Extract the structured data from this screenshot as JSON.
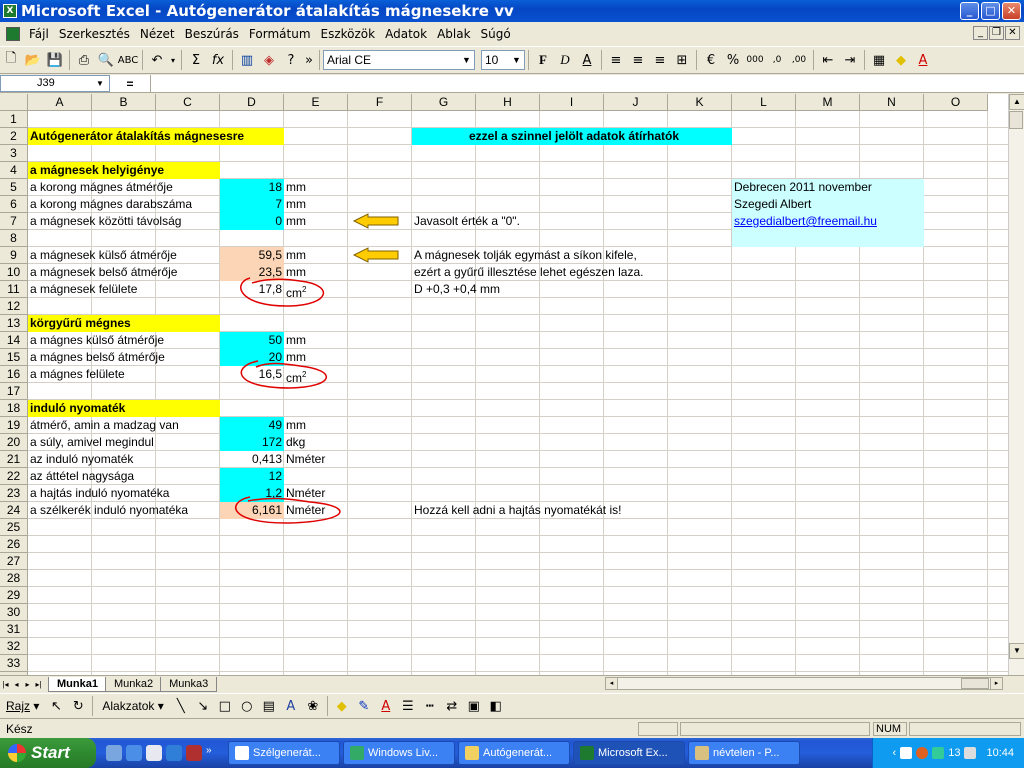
{
  "window": {
    "title": "Microsoft Excel - Autógenerátor átalakítás mágnesekre vv"
  },
  "menu": [
    "Fájl",
    "Szerkesztés",
    "Nézet",
    "Beszúrás",
    "Formátum",
    "Eszközök",
    "Adatok",
    "Ablak",
    "Súgó"
  ],
  "toolbar": {
    "font": "Arial CE",
    "size": "10"
  },
  "formula": {
    "cell_ref": "J39",
    "fx": "="
  },
  "columns": [
    "A",
    "B",
    "C",
    "D",
    "E",
    "F",
    "G",
    "H",
    "I",
    "J",
    "K",
    "L",
    "M",
    "N",
    "O"
  ],
  "rows": [
    "1",
    "2",
    "3",
    "4",
    "5",
    "6",
    "7",
    "8",
    "9",
    "10",
    "11",
    "12",
    "13",
    "14",
    "15",
    "16",
    "17",
    "18",
    "19",
    "20",
    "21",
    "22",
    "23",
    "24",
    "25",
    "26",
    "27",
    "28",
    "29",
    "30",
    "31",
    "32",
    "33",
    "34"
  ],
  "cells": {
    "r2a": "Autógenerátor átalakítás mágnesesre",
    "r2g": "ezzel a szinnel jelölt adatok átírhatók",
    "r4a": "a mágnesek helyigénye",
    "r5a": "a korong mágnes átmérője",
    "r5d": "18",
    "r5e": "mm",
    "r5l": "Debrecen 2011 november",
    "r6a": "a korong mágnes darabszáma",
    "r6d": "7",
    "r6e": "mm",
    "r6l": "Szegedi Albert",
    "r7a": "a mágnesek közötti távolság",
    "r7d": "0",
    "r7e": "mm",
    "r7g": "Javasolt érték a \"0\".",
    "r7l": "szegedialbert@freemail.hu",
    "r9a": "a mágnesek külső átmérője",
    "r9d": "59,5",
    "r9e": "mm",
    "r9g": "A mágnesek tolják egymást a síkon kifele,",
    "r10a": "a mágnesek belső átmérője",
    "r10d": "23,5",
    "r10e": "mm",
    "r10g": "ezért a gyűrű illesztése lehet egészen laza.",
    "r11a": "a mágnesek felülete",
    "r11d": "17,8",
    "r11e": "cm",
    "r11g": "D +0,3  +0,4  mm",
    "r13a": "körgyűrű mégnes",
    "r14a": "a mágnes külső átmérője",
    "r14d": "50",
    "r14e": "mm",
    "r15a": "a mágnes belső átmérője",
    "r15d": "20",
    "r15e": "mm",
    "r16a": "a mágnes felülete",
    "r16d": "16,5",
    "r16e": "cm",
    "r18a": "induló nyomaték",
    "r19a": "átmérő, amin a madzag van",
    "r19d": "49",
    "r19e": "mm",
    "r20a": "a súly, amivel megindul",
    "r20d": "172",
    "r20e": "dkg",
    "r21a": "az induló nyomaték",
    "r21d": "0,413",
    "r21e": "Nméter",
    "r22a": "az áttétel nagysága",
    "r22d": "12",
    "r23a": "a hajtás induló nyomatéka",
    "r23d": "1,2",
    "r23e": "Nméter",
    "r24a": "a szélkerék induló nyomatéka",
    "r24d": "6,161",
    "r24e": "Nméter",
    "r24g": "Hozzá kell adni a hajtás nyomatékát is!",
    "sup": "2"
  },
  "sheets": [
    "Munka1",
    "Munka2",
    "Munka3"
  ],
  "drawing": {
    "rajz": "Rajz",
    "shapes": "Alakzatok"
  },
  "status": {
    "ready": "Kész",
    "num": "NUM"
  },
  "taskbar": {
    "start": "Start",
    "tasks": [
      "Szélgenerát...",
      "Windows Liv...",
      "Autógenerát...",
      "Microsoft Ex...",
      "névtelen - P..."
    ],
    "clock": "10:44",
    "tray_count": "13"
  },
  "colors": {
    "cyan": "#00ffff",
    "peach": "#fbd5b5",
    "yellow": "#ffff00",
    "annotation": "#e00000"
  }
}
